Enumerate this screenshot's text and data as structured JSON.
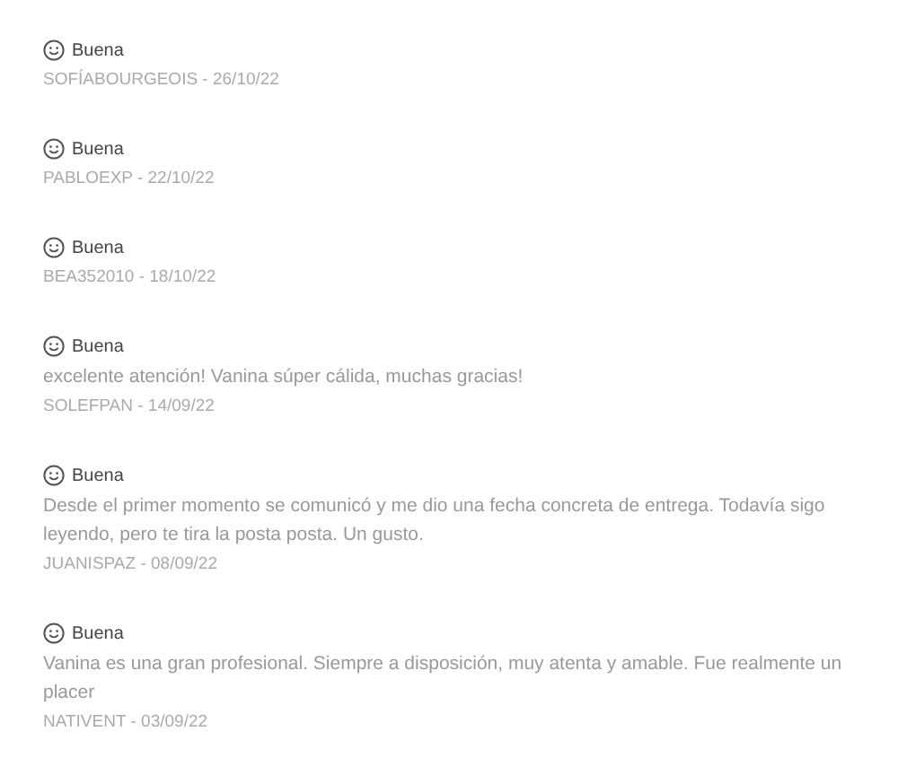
{
  "reviews": [
    {
      "rating": "Buena",
      "author_date": "SOFÍABOURGEOIS - 26/10/22"
    },
    {
      "rating": "Buena",
      "author_date": "PABLOEXP - 22/10/22"
    },
    {
      "rating": "Buena",
      "author_date": "BEA352010 - 18/10/22"
    },
    {
      "rating": "Buena",
      "comment": "excelente atención! Vanina súper cálida, muchas gracias!",
      "author_date": "SOLEFPAN - 14/09/22"
    },
    {
      "rating": "Buena",
      "comment": "Desde el primer momento se comunicó y me dio una fecha concreta de entrega. Todavía sigo leyendo, pero te tira la posta posta. Un gusto.",
      "author_date": "JUANISPAZ - 08/09/22"
    },
    {
      "rating": "Buena",
      "comment": "Vanina es una gran profesional. Siempre a disposición, muy atenta y amable. Fue realmente un placer",
      "author_date": "NATIVENT - 03/09/22"
    }
  ]
}
